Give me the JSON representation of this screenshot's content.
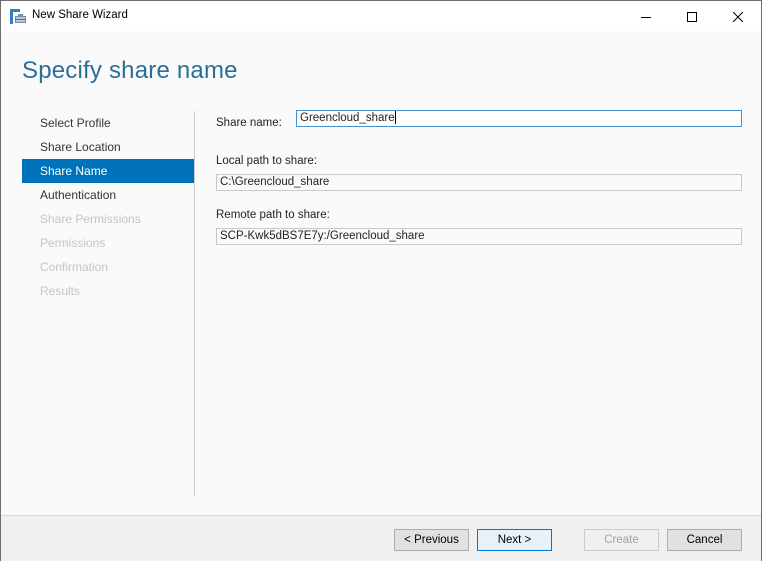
{
  "window": {
    "title": "New Share Wizard",
    "app_icon": "share-wizard-icon",
    "controls": {
      "minimize_icon": "minimize-icon",
      "maximize_icon": "maximize-icon",
      "close_icon": "close-icon"
    }
  },
  "page": {
    "title": "Specify share name"
  },
  "nav": {
    "items": [
      {
        "label": "Select Profile",
        "state": "normal"
      },
      {
        "label": "Share Location",
        "state": "normal"
      },
      {
        "label": "Share Name",
        "state": "active"
      },
      {
        "label": "Authentication",
        "state": "normal"
      },
      {
        "label": "Share Permissions",
        "state": "disabled"
      },
      {
        "label": "Permissions",
        "state": "disabled"
      },
      {
        "label": "Confirmation",
        "state": "disabled"
      },
      {
        "label": "Results",
        "state": "disabled"
      }
    ]
  },
  "form": {
    "share_name_label": "Share name:",
    "share_name_value": "Greencloud_share",
    "local_path_label": "Local path to share:",
    "local_path_value": "C:\\Greencloud_share",
    "remote_path_label": "Remote path to share:",
    "remote_path_value": "SCP-Kwk5dBS7E7y:/Greencloud_share"
  },
  "footer": {
    "previous_label": "< Previous",
    "next_label": "Next >",
    "create_label": "Create",
    "cancel_label": "Cancel"
  },
  "colors": {
    "accent": "#0072bc",
    "title": "#2b6f99",
    "disabled_text": "#c4c4c4"
  }
}
